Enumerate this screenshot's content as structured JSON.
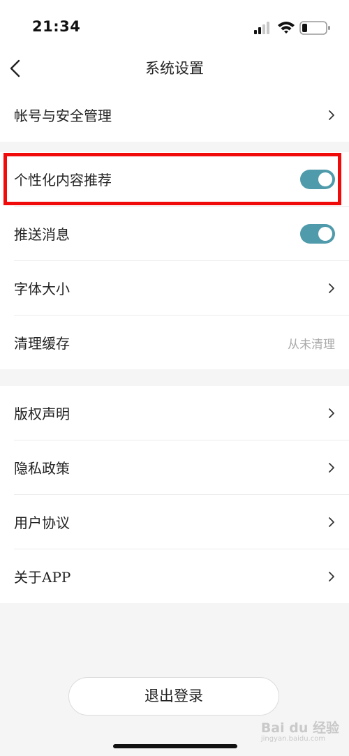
{
  "status_bar": {
    "time": "21:34"
  },
  "nav": {
    "title": "系统设置"
  },
  "groups": [
    {
      "rows": [
        {
          "label": "帐号与安全管理"
        }
      ]
    },
    {
      "rows": [
        {
          "label": "个性化内容推荐",
          "toggle_on": true
        },
        {
          "label": "推送消息",
          "toggle_on": true
        },
        {
          "label": "字体大小"
        },
        {
          "label": "清理缓存",
          "value": "从未清理"
        }
      ]
    },
    {
      "rows": [
        {
          "label": "版权声明"
        },
        {
          "label": "隐私政策"
        },
        {
          "label": "用户协议"
        },
        {
          "label": "关于APP"
        }
      ]
    }
  ],
  "logout_label": "退出登录",
  "watermark": {
    "text": "Bai du 经验",
    "sub": "jingyan.baidu.com"
  },
  "colors": {
    "toggle_on": "#4f9bab",
    "highlight": "#f00a0a"
  }
}
